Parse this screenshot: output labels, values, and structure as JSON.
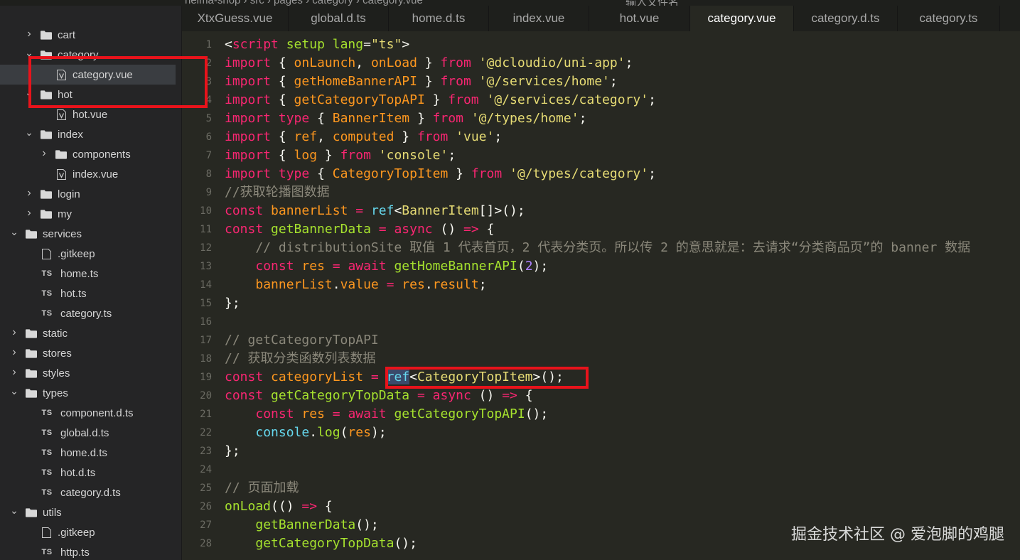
{
  "topbar": {
    "breadcrumb": "heima-shop  ›  src  ›  pages  ›  category  ›  category.vue",
    "search_placeholder": "输入文件名"
  },
  "sidebar": {
    "items": [
      {
        "label": "cart",
        "type": "folder",
        "state": "collapsed",
        "depth": 1
      },
      {
        "label": "category",
        "type": "folder",
        "state": "expanded",
        "depth": 1
      },
      {
        "label": "category.vue",
        "type": "vue",
        "depth": 2,
        "selected": true
      },
      {
        "label": "hot",
        "type": "folder",
        "state": "expanded",
        "depth": 1
      },
      {
        "label": "hot.vue",
        "type": "vue",
        "depth": 2
      },
      {
        "label": "index",
        "type": "folder",
        "state": "expanded",
        "depth": 1
      },
      {
        "label": "components",
        "type": "folder",
        "state": "collapsed",
        "depth": 2
      },
      {
        "label": "index.vue",
        "type": "vue",
        "depth": 2
      },
      {
        "label": "login",
        "type": "folder",
        "state": "collapsed",
        "depth": 1
      },
      {
        "label": "my",
        "type": "folder",
        "state": "collapsed",
        "depth": 1
      },
      {
        "label": "services",
        "type": "folder",
        "state": "expanded",
        "depth": 0
      },
      {
        "label": ".gitkeep",
        "type": "file",
        "depth": 1
      },
      {
        "label": "home.ts",
        "type": "ts",
        "depth": 1
      },
      {
        "label": "hot.ts",
        "type": "ts",
        "depth": 1
      },
      {
        "label": "category.ts",
        "type": "ts",
        "depth": 1
      },
      {
        "label": "static",
        "type": "folder",
        "state": "collapsed",
        "depth": 0
      },
      {
        "label": "stores",
        "type": "folder",
        "state": "collapsed",
        "depth": 0
      },
      {
        "label": "styles",
        "type": "folder",
        "state": "collapsed",
        "depth": 0
      },
      {
        "label": "types",
        "type": "folder",
        "state": "expanded",
        "depth": 0
      },
      {
        "label": "component.d.ts",
        "type": "ts",
        "depth": 1
      },
      {
        "label": "global.d.ts",
        "type": "ts",
        "depth": 1
      },
      {
        "label": "home.d.ts",
        "type": "ts",
        "depth": 1
      },
      {
        "label": "hot.d.ts",
        "type": "ts",
        "depth": 1
      },
      {
        "label": "category.d.ts",
        "type": "ts",
        "depth": 1
      },
      {
        "label": "utils",
        "type": "folder",
        "state": "expanded",
        "depth": 0
      },
      {
        "label": ".gitkeep",
        "type": "file",
        "depth": 1
      },
      {
        "label": "http.ts",
        "type": "ts",
        "depth": 1
      }
    ],
    "ts_badge": "TS"
  },
  "tabs": [
    {
      "label": "XtxGuess.vue"
    },
    {
      "label": "global.d.ts"
    },
    {
      "label": "home.d.ts"
    },
    {
      "label": "index.vue"
    },
    {
      "label": "hot.vue"
    },
    {
      "label": "category.vue",
      "active": true
    },
    {
      "label": "category.d.ts"
    },
    {
      "label": "category.ts"
    }
  ],
  "editor": {
    "line_numbers": [
      "1",
      "2",
      "3",
      "4",
      "5",
      "6",
      "7",
      "8",
      "9",
      "10",
      "11",
      "12",
      "13",
      "14",
      "15",
      "16",
      "17",
      "18",
      "19",
      "20",
      "21",
      "22",
      "23",
      "24",
      "25",
      "26",
      "27",
      "28"
    ],
    "lines": [
      [
        [
          "p",
          "<"
        ],
        [
          "k",
          "script"
        ],
        [
          "p",
          " "
        ],
        [
          "f",
          "setup"
        ],
        [
          "p",
          " "
        ],
        [
          "f",
          "lang"
        ],
        [
          "p",
          "="
        ],
        [
          "s",
          "\"ts\""
        ],
        [
          "p",
          ">"
        ]
      ],
      [
        [
          "k",
          "import"
        ],
        [
          "p",
          " { "
        ],
        [
          "n",
          "onLaunch"
        ],
        [
          "p",
          ", "
        ],
        [
          "n",
          "onLoad"
        ],
        [
          "p",
          " } "
        ],
        [
          "k",
          "from"
        ],
        [
          "p",
          " "
        ],
        [
          "s",
          "'@dcloudio/uni-app'"
        ],
        [
          "p",
          ";"
        ]
      ],
      [
        [
          "k",
          "import"
        ],
        [
          "p",
          " { "
        ],
        [
          "n",
          "getHomeBannerAPI"
        ],
        [
          "p",
          " } "
        ],
        [
          "k",
          "from"
        ],
        [
          "p",
          " "
        ],
        [
          "s",
          "'@/services/home'"
        ],
        [
          "p",
          ";"
        ]
      ],
      [
        [
          "k",
          "import"
        ],
        [
          "p",
          " { "
        ],
        [
          "n",
          "getCategoryTopAPI"
        ],
        [
          "p",
          " } "
        ],
        [
          "k",
          "from"
        ],
        [
          "p",
          " "
        ],
        [
          "s",
          "'@/services/category'"
        ],
        [
          "p",
          ";"
        ]
      ],
      [
        [
          "k",
          "import"
        ],
        [
          "p",
          " "
        ],
        [
          "k",
          "type"
        ],
        [
          "p",
          " { "
        ],
        [
          "n",
          "BannerItem"
        ],
        [
          "p",
          " } "
        ],
        [
          "k",
          "from"
        ],
        [
          "p",
          " "
        ],
        [
          "s",
          "'@/types/home'"
        ],
        [
          "p",
          ";"
        ]
      ],
      [
        [
          "k",
          "import"
        ],
        [
          "p",
          " { "
        ],
        [
          "n",
          "ref"
        ],
        [
          "p",
          ", "
        ],
        [
          "n",
          "computed"
        ],
        [
          "p",
          " } "
        ],
        [
          "k",
          "from"
        ],
        [
          "p",
          " "
        ],
        [
          "s",
          "'vue'"
        ],
        [
          "p",
          ";"
        ]
      ],
      [
        [
          "k",
          "import"
        ],
        [
          "p",
          " { "
        ],
        [
          "n",
          "log"
        ],
        [
          "p",
          " } "
        ],
        [
          "k",
          "from"
        ],
        [
          "p",
          " "
        ],
        [
          "s",
          "'console'"
        ],
        [
          "p",
          ";"
        ]
      ],
      [
        [
          "k",
          "import"
        ],
        [
          "p",
          " "
        ],
        [
          "k",
          "type"
        ],
        [
          "p",
          " { "
        ],
        [
          "n",
          "CategoryTopItem"
        ],
        [
          "p",
          " } "
        ],
        [
          "k",
          "from"
        ],
        [
          "p",
          " "
        ],
        [
          "s",
          "'@/types/category'"
        ],
        [
          "p",
          ";"
        ]
      ],
      [
        [
          "c",
          "//获取轮播图数据"
        ]
      ],
      [
        [
          "k",
          "const"
        ],
        [
          "p",
          " "
        ],
        [
          "n",
          "bannerList"
        ],
        [
          "p",
          " "
        ],
        [
          "k",
          "="
        ],
        [
          "p",
          " "
        ],
        [
          "t",
          "ref"
        ],
        [
          "p",
          "<"
        ],
        [
          "cls",
          "BannerItem"
        ],
        [
          "p",
          "[]>();"
        ]
      ],
      [
        [
          "k",
          "const"
        ],
        [
          "p",
          " "
        ],
        [
          "f",
          "getBannerData"
        ],
        [
          "p",
          " "
        ],
        [
          "k",
          "="
        ],
        [
          "p",
          " "
        ],
        [
          "k",
          "async"
        ],
        [
          "p",
          " () "
        ],
        [
          "k",
          "=>"
        ],
        [
          "p",
          " {"
        ]
      ],
      [
        [
          "p",
          "    "
        ],
        [
          "c",
          "// distributionSite 取值 1 代表首页，2 代表分类页。所以传 2 的意思就是：去请求“分类商品页”的 banner 数据"
        ]
      ],
      [
        [
          "p",
          "    "
        ],
        [
          "k",
          "const"
        ],
        [
          "p",
          " "
        ],
        [
          "n",
          "res"
        ],
        [
          "p",
          " "
        ],
        [
          "k",
          "="
        ],
        [
          "p",
          " "
        ],
        [
          "k",
          "await"
        ],
        [
          "p",
          " "
        ],
        [
          "f",
          "getHomeBannerAPI"
        ],
        [
          "p",
          "("
        ],
        [
          "num",
          "2"
        ],
        [
          "p",
          ");"
        ]
      ],
      [
        [
          "p",
          "    "
        ],
        [
          "n",
          "bannerList"
        ],
        [
          "p",
          "."
        ],
        [
          "n",
          "value"
        ],
        [
          "p",
          " "
        ],
        [
          "k",
          "="
        ],
        [
          "p",
          " "
        ],
        [
          "n",
          "res"
        ],
        [
          "p",
          "."
        ],
        [
          "n",
          "result"
        ],
        [
          "p",
          ";"
        ]
      ],
      [
        [
          "p",
          "};"
        ]
      ],
      [],
      [
        [
          "c",
          "// getCategoryTopAPI"
        ]
      ],
      [
        [
          "c",
          "// 获取分类函数列表数据"
        ]
      ],
      [
        [
          "k",
          "const"
        ],
        [
          "p",
          " "
        ],
        [
          "n",
          "categoryList"
        ],
        [
          "p",
          " "
        ],
        [
          "k",
          "="
        ],
        [
          "p",
          " "
        ],
        [
          "t",
          "ref"
        ],
        [
          "p",
          "<"
        ],
        [
          "cls",
          "CategoryTopItem"
        ],
        [
          "p",
          ">();"
        ]
      ],
      [
        [
          "k",
          "const"
        ],
        [
          "p",
          " "
        ],
        [
          "f",
          "getCategoryTopData"
        ],
        [
          "p",
          " "
        ],
        [
          "k",
          "="
        ],
        [
          "p",
          " "
        ],
        [
          "k",
          "async"
        ],
        [
          "p",
          " () "
        ],
        [
          "k",
          "=>"
        ],
        [
          "p",
          " {"
        ]
      ],
      [
        [
          "p",
          "    "
        ],
        [
          "k",
          "const"
        ],
        [
          "p",
          " "
        ],
        [
          "n",
          "res"
        ],
        [
          "p",
          " "
        ],
        [
          "k",
          "="
        ],
        [
          "p",
          " "
        ],
        [
          "k",
          "await"
        ],
        [
          "p",
          " "
        ],
        [
          "f",
          "getCategoryTopAPI"
        ],
        [
          "p",
          "();"
        ]
      ],
      [
        [
          "p",
          "    "
        ],
        [
          "t",
          "console"
        ],
        [
          "p",
          "."
        ],
        [
          "f",
          "log"
        ],
        [
          "p",
          "("
        ],
        [
          "n",
          "res"
        ],
        [
          "p",
          ");"
        ]
      ],
      [
        [
          "p",
          "};"
        ]
      ],
      [],
      [
        [
          "c",
          "// 页面加载"
        ]
      ],
      [
        [
          "f",
          "onLoad"
        ],
        [
          "p",
          "(() "
        ],
        [
          "k",
          "=>"
        ],
        [
          "p",
          " {"
        ]
      ],
      [
        [
          "p",
          "    "
        ],
        [
          "f",
          "getBannerData"
        ],
        [
          "p",
          "();"
        ]
      ],
      [
        [
          "p",
          "    "
        ],
        [
          "f",
          "getCategoryTopData"
        ],
        [
          "p",
          "();"
        ]
      ]
    ]
  },
  "watermark": "掘金技术社区 @ 爱泡脚的鸡腿",
  "colors": {
    "annotation_red": "#e8131b",
    "keyword": "#f92672",
    "string": "#e6db74",
    "function": "#a6e22e",
    "builtin": "#66d9ef",
    "comment": "#8a877a",
    "variable": "#fd971f",
    "number": "#ae81ff"
  }
}
